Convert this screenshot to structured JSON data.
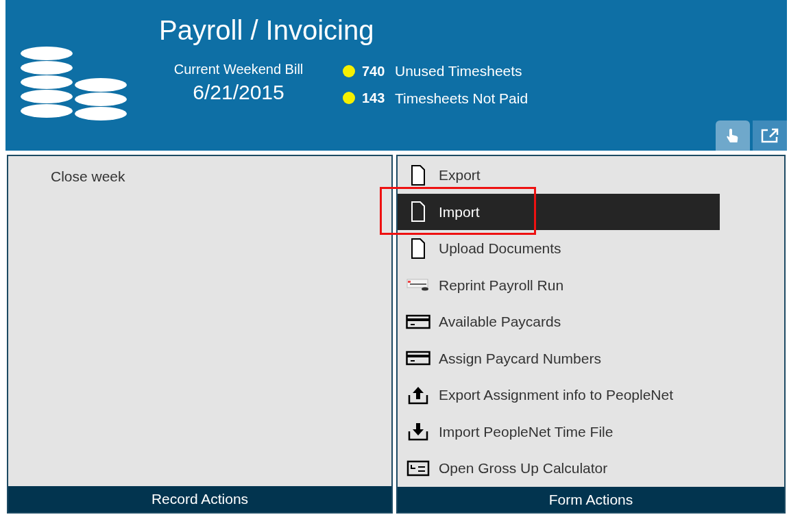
{
  "header": {
    "title": "Payroll / Invoicing",
    "bill_label": "Current Weekend Bill",
    "bill_date": "6/21/2015",
    "stats": [
      {
        "count": "740",
        "label": "Unused Timesheets",
        "color": "#f5f000"
      },
      {
        "count": "143",
        "label": "Timesheets Not Paid",
        "color": "#f5f000"
      }
    ],
    "view_buttons": [
      {
        "kind": "hand",
        "selected": true
      },
      {
        "kind": "popout",
        "selected": false
      }
    ]
  },
  "record_actions": {
    "items": [
      {
        "label": "Close week"
      }
    ],
    "footer": "Record Actions"
  },
  "form_actions": {
    "items": [
      {
        "kind": "document",
        "label": "Export",
        "selected": false,
        "annotated": false
      },
      {
        "kind": "document",
        "label": "Import",
        "selected": true,
        "annotated": true
      },
      {
        "kind": "document",
        "label": "Upload Documents",
        "selected": false,
        "annotated": false
      },
      {
        "kind": "printer",
        "label": "Reprint Payroll Run",
        "selected": false,
        "annotated": false
      },
      {
        "kind": "card",
        "label": "Available Paycards",
        "selected": false,
        "annotated": false
      },
      {
        "kind": "card",
        "label": "Assign Paycard Numbers",
        "selected": false,
        "annotated": false
      },
      {
        "kind": "upload",
        "label": "Export Assignment info to PeopleNet",
        "selected": false,
        "annotated": false
      },
      {
        "kind": "download",
        "label": "Import PeopleNet Time File",
        "selected": false,
        "annotated": false
      },
      {
        "kind": "calculator",
        "label": "Open Gross Up Calculator",
        "selected": false,
        "annotated": false
      }
    ],
    "footer": "Form Actions"
  }
}
